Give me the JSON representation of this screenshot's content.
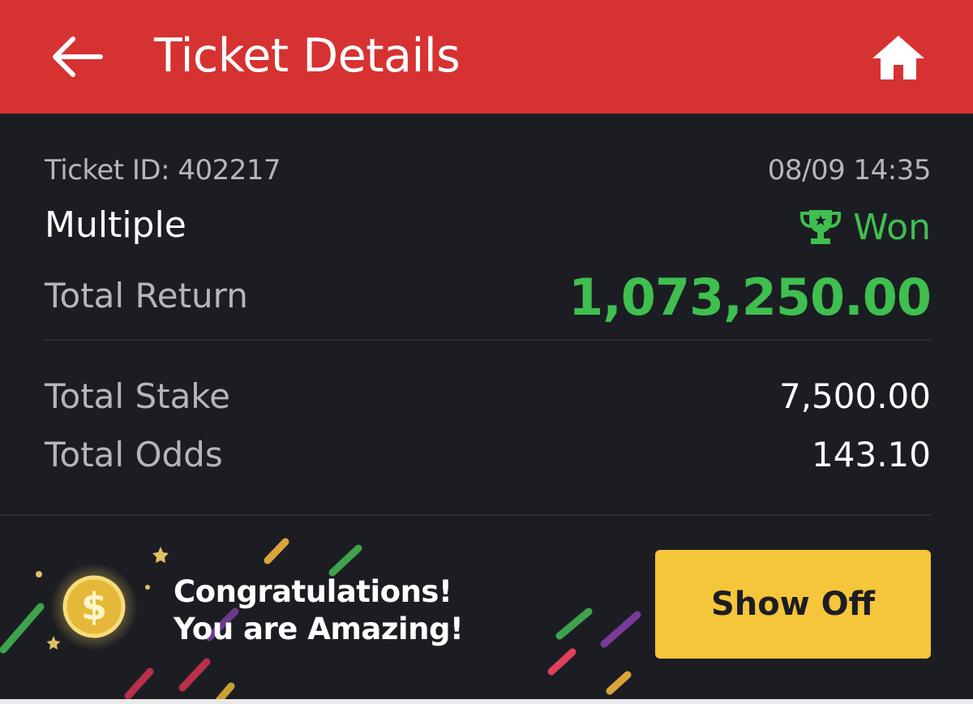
{
  "header": {
    "title": "Ticket Details",
    "back_icon": "arrow-left-icon",
    "home_icon": "home-icon",
    "background_color": "#d63232"
  },
  "ticket": {
    "id_text": "Ticket ID: 402217",
    "datetime": "08/09 14:35",
    "bet_type": "Multiple",
    "status": "Won",
    "status_icon": "trophy-icon",
    "status_color": "#3fbf4f",
    "total_return_label": "Total Return",
    "total_return_value": "1,073,250.00",
    "total_stake_label": "Total Stake",
    "total_stake_value": "7,500.00",
    "total_odds_label": "Total Odds",
    "total_odds_value": "143.10"
  },
  "banner": {
    "line1": "Congratulations!",
    "line2": "You are Amazing!",
    "coin_icon": "coin-icon",
    "button_label": "Show Off",
    "button_color": "#f5c53a"
  }
}
